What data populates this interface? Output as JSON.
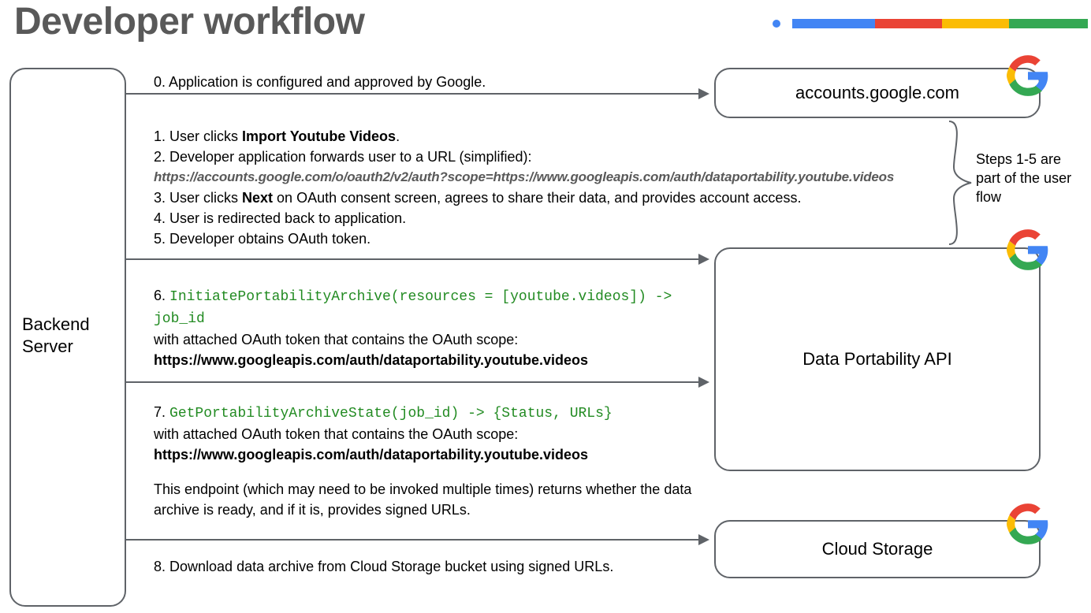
{
  "title": "Developer workflow",
  "actors": {
    "backend": "Backend\nServer",
    "accounts": "accounts.google.com",
    "dpapi": "Data Portability API",
    "storage": "Cloud Storage"
  },
  "steps": {
    "s0": "0. Application is configured and approved by Google.",
    "s1_prefix": "1. User clicks ",
    "s1_bold": "Import Youtube Videos",
    "s1_suffix": ".",
    "s2": "2. Developer application forwards user to a URL (simplified):",
    "s2_url": "https://accounts.google.com/o/oauth2/v2/auth?scope=https://www.googleapis.com/auth/dataportability.youtube.videos",
    "s3_prefix": "3. User clicks ",
    "s3_bold": "Next",
    "s3_suffix": " on OAuth consent screen, agrees to share their data, and provides account access.",
    "s4": "4. User is redirected back to application.",
    "s5": "5. Developer obtains OAuth token.",
    "s6_num": "6. ",
    "s6_code": "InitiatePortabilityArchive(resources = [youtube.videos]) -> job_id",
    "s6_text": "with attached OAuth token that contains the OAuth scope:",
    "s6_scope": "https://www.googleapis.com/auth/dataportability.youtube.videos",
    "s7_num": "7. ",
    "s7_code": "GetPortabilityArchiveState(job_id) -> {Status, URLs}",
    "s7_text": "with attached OAuth token that contains the OAuth scope:",
    "s7_scope": "https://www.googleapis.com/auth/dataportability.youtube.videos",
    "s7_extra": "This endpoint (which may need to be invoked multiple times) returns whether the data archive is ready, and if it is, provides signed URLs.",
    "s8": "8. Download data archive from Cloud Storage bucket using signed URLs."
  },
  "brace_note": "Steps 1-5 are part of the user flow"
}
